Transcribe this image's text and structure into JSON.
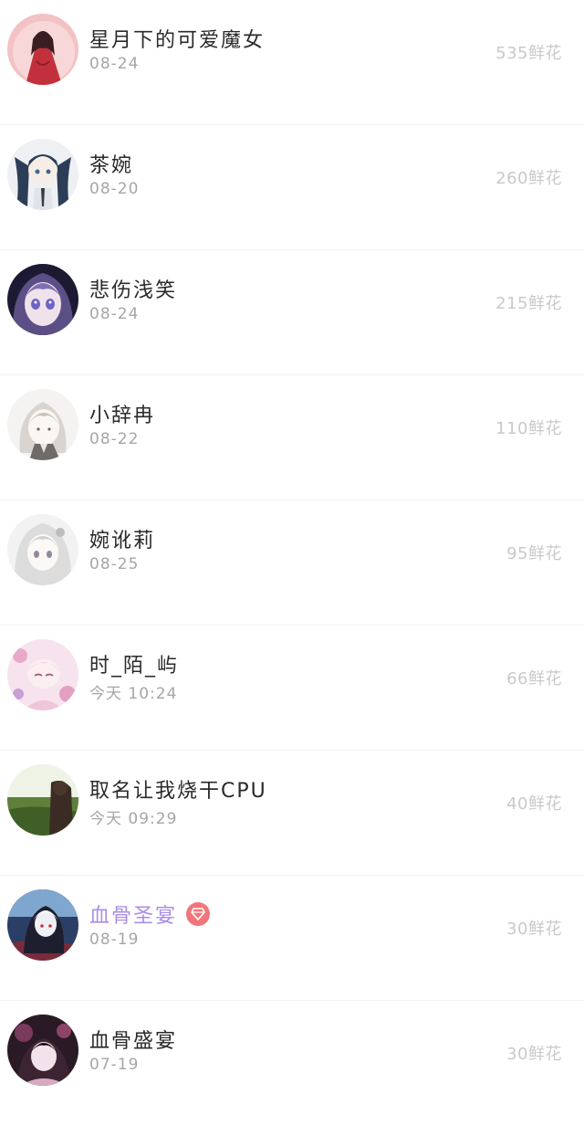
{
  "rows": [
    {
      "name": "星月下的可爱魔女",
      "date": "08-24",
      "flowers": "535鲜花",
      "avatar_icon": "avatar-red-dress-girl",
      "vip": false
    },
    {
      "name": "茶婉",
      "date": "08-20",
      "flowers": "260鲜花",
      "avatar_icon": "avatar-twin-tail-girl",
      "vip": false
    },
    {
      "name": "悲伤浅笑",
      "date": "08-24",
      "flowers": "215鲜花",
      "avatar_icon": "avatar-purple-hair-girl",
      "vip": false
    },
    {
      "name": "小辞冉",
      "date": "08-22",
      "flowers": "110鲜花",
      "avatar_icon": "avatar-sketch-girl",
      "vip": false
    },
    {
      "name": "婉讹莉",
      "date": "08-25",
      "flowers": "95鲜花",
      "avatar_icon": "avatar-white-hair-girl",
      "vip": false
    },
    {
      "name": "时_陌_屿",
      "date": "今天 10:24",
      "flowers": "66鲜花",
      "avatar_icon": "avatar-pink-floral-girl",
      "vip": false
    },
    {
      "name": "取名让我烧干CPU",
      "date": "今天 09:29",
      "flowers": "40鲜花",
      "avatar_icon": "avatar-field-landscape",
      "vip": false
    },
    {
      "name": "血骨圣宴",
      "date": "08-19",
      "flowers": "30鲜花",
      "avatar_icon": "avatar-dark-blue-girl",
      "vip": true,
      "badge_icon": "diamond-icon"
    },
    {
      "name": "血骨盛宴",
      "date": "07-19",
      "flowers": "30鲜花",
      "avatar_icon": "avatar-dark-pink-girl",
      "vip": false
    }
  ],
  "colors": {
    "name": "#2a2a2a",
    "vip_name": "#a98de8",
    "date": "#a6a6a8",
    "flowers": "#c9c9cb",
    "badge": "#f0767b",
    "divider": "#f1f1f3"
  }
}
